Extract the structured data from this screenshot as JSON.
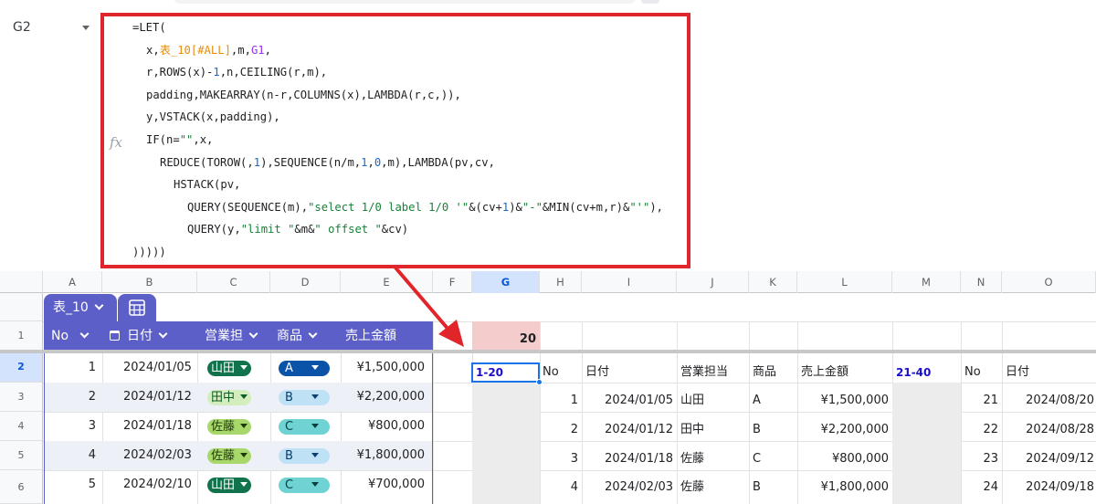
{
  "name_box": {
    "value": "G2"
  },
  "formula_bar": {
    "fx_label": "fx",
    "lines": [
      [
        {
          "t": "=LET("
        }
      ],
      [
        {
          "t": "x,"
        },
        {
          "t": "表_10[#ALL]",
          "c": "ref"
        },
        {
          "t": ",m,"
        },
        {
          "t": "G1",
          "c": "purple"
        },
        {
          "t": ","
        }
      ],
      [
        {
          "t": "r,ROWS(x)-"
        },
        {
          "t": "1",
          "c": "num"
        },
        {
          "t": ",n,CEILING(r,m),"
        }
      ],
      [
        {
          "t": "padding,MAKEARRAY(n-r,COLUMNS(x),LAMBDA(r,c,)),"
        }
      ],
      [
        {
          "t": "y,VSTACK(x,padding),"
        }
      ],
      [
        {
          "t": "IF(n="
        },
        {
          "t": "\"\"",
          "c": "str"
        },
        {
          "t": ",x,"
        }
      ],
      [
        {
          "t": "REDUCE(TOROW(,"
        },
        {
          "t": "1",
          "c": "num"
        },
        {
          "t": "),SEQUENCE(n/m,"
        },
        {
          "t": "1",
          "c": "num"
        },
        {
          "t": ","
        },
        {
          "t": "0",
          "c": "num"
        },
        {
          "t": ",m),LAMBDA(pv,cv,"
        }
      ],
      [
        {
          "t": "HSTACK(pv,"
        }
      ],
      [
        {
          "t": "QUERY(SEQUENCE(m),"
        },
        {
          "t": "\"select 1/0 label 1/0 '\"",
          "c": "str"
        },
        {
          "t": "&(cv+"
        },
        {
          "t": "1",
          "c": "num"
        },
        {
          "t": ")&"
        },
        {
          "t": "\"-\"",
          "c": "str"
        },
        {
          "t": "&MIN(cv+m,r)&"
        },
        {
          "t": "\"'\"",
          "c": "str"
        },
        {
          "t": "),"
        }
      ],
      [
        {
          "t": "QUERY(y,"
        },
        {
          "t": "\"limit \"",
          "c": "str"
        },
        {
          "t": "&m&"
        },
        {
          "t": "\" offset \"",
          "c": "str"
        },
        {
          "t": "&cv)"
        }
      ],
      [
        {
          "t": ")))))"
        }
      ]
    ]
  },
  "columns": [
    "A",
    "B",
    "C",
    "D",
    "E",
    "F",
    "G",
    "H",
    "I",
    "J",
    "K",
    "L",
    "M",
    "N",
    "O"
  ],
  "rows": [
    "1",
    "2",
    "3",
    "4",
    "5",
    "6"
  ],
  "table": {
    "tab_name": "表_10",
    "headers": [
      "No",
      "日付",
      "営業担",
      "商品",
      "売上金額"
    ],
    "rows": [
      {
        "no": "1",
        "date": "2024/01/05",
        "rep": "山田",
        "item": "A",
        "amount": "¥1,500,000"
      },
      {
        "no": "2",
        "date": "2024/01/12",
        "rep": "田中",
        "item": "B",
        "amount": "¥2,200,000"
      },
      {
        "no": "3",
        "date": "2024/01/18",
        "rep": "佐藤",
        "item": "C",
        "amount": "¥800,000"
      },
      {
        "no": "4",
        "date": "2024/02/03",
        "rep": "佐藤",
        "item": "B",
        "amount": "¥1,800,000"
      },
      {
        "no": "5",
        "date": "2024/02/10",
        "rep": "山田",
        "item": "C",
        "amount": "¥700,000"
      }
    ],
    "rep_colors": {
      "山田": {
        "bg": "#11734b",
        "fg": "#ffffff"
      },
      "田中": {
        "bg": "#d4edbc",
        "fg": "#0a5a2c"
      },
      "佐藤": {
        "bg": "#a8d86b",
        "fg": "#1e3a0a"
      }
    },
    "item_colors": {
      "A": {
        "bg": "#0a53a8",
        "fg": "#ffffff"
      },
      "B": {
        "bg": "#bfe1f6",
        "fg": "#0a3f6b"
      },
      "C": {
        "bg": "#6fd3d3",
        "fg": "#0a3f3f"
      }
    }
  },
  "cells": {
    "G1": "20",
    "G2": "1-20",
    "M2": "21-40",
    "headers_block1": [
      "No",
      "日付",
      "営業担当",
      "商品",
      "売上金額"
    ],
    "headers_block2": [
      "No",
      "日付"
    ],
    "block1": [
      {
        "no": "1",
        "date": "2024/01/05",
        "rep": "山田",
        "item": "A",
        "amount": "¥1,500,000"
      },
      {
        "no": "2",
        "date": "2024/01/12",
        "rep": "田中",
        "item": "B",
        "amount": "¥2,200,000"
      },
      {
        "no": "3",
        "date": "2024/01/18",
        "rep": "佐藤",
        "item": "C",
        "amount": "¥800,000"
      },
      {
        "no": "4",
        "date": "2024/02/03",
        "rep": "佐藤",
        "item": "B",
        "amount": "¥1,800,000"
      }
    ],
    "block2": [
      {
        "no": "21",
        "date": "2024/08/20"
      },
      {
        "no": "22",
        "date": "2024/08/28"
      },
      {
        "no": "23",
        "date": "2024/09/12"
      },
      {
        "no": "24",
        "date": "2024/09/18"
      }
    ]
  },
  "colors": {
    "highlight_box": "#e0262a",
    "table_header": "#5b5fc7",
    "selection": "#1a73e8",
    "g1_fill": "#f4cccc",
    "range_label": "#1a0dcc"
  }
}
